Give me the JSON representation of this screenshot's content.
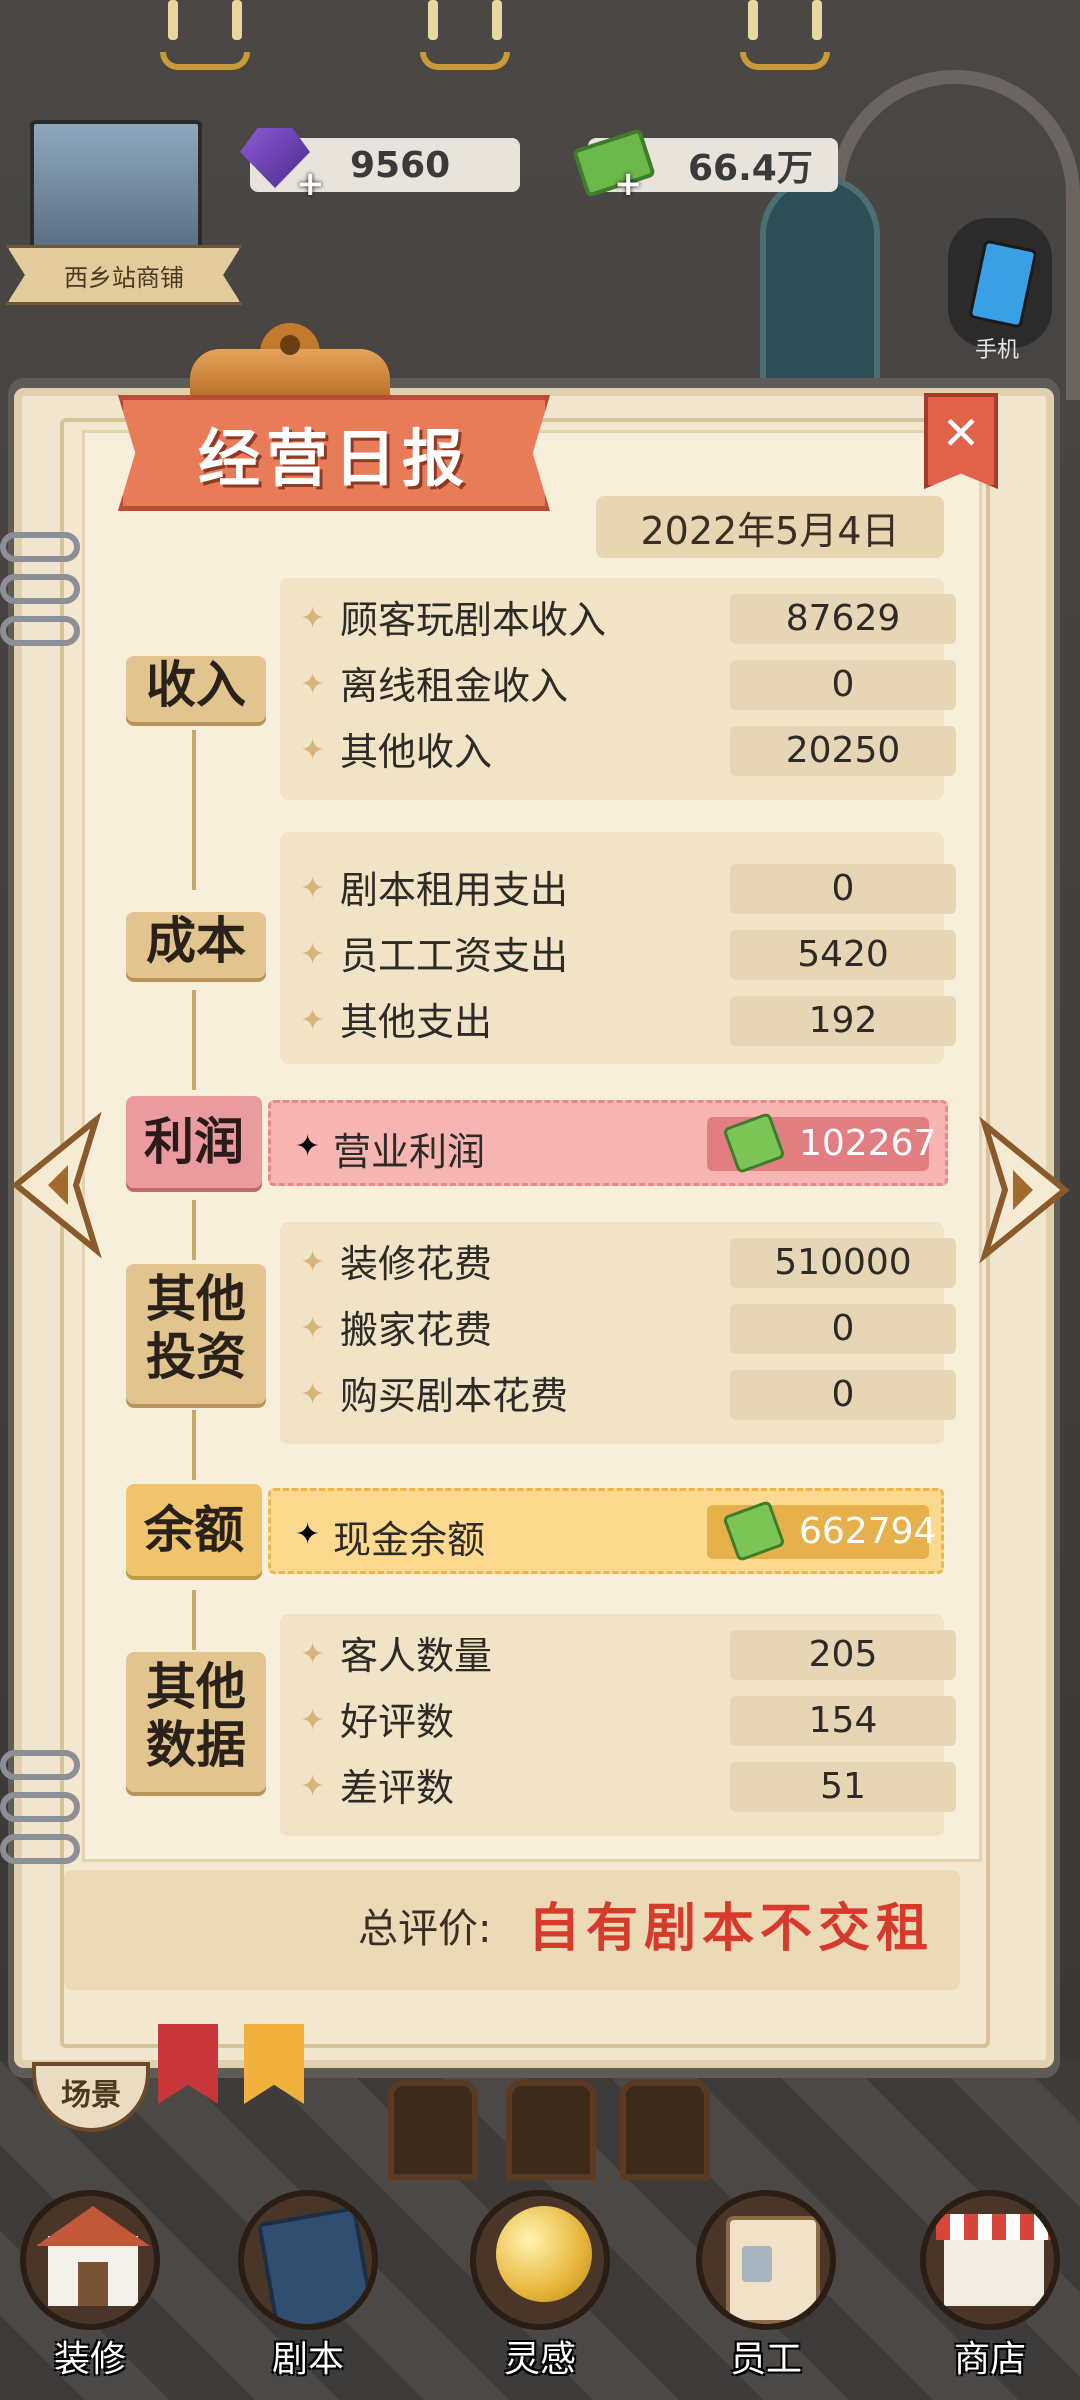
{
  "topbar": {
    "gems": "9560",
    "cash": "66.4万",
    "shop_name": "西乡站商铺",
    "phone_label": "手机"
  },
  "report": {
    "title": "经营日报",
    "close_symbol": "✕",
    "date": "2022年5月4日",
    "income": {
      "category": "收入",
      "rows": [
        {
          "label": "顾客玩剧本收入",
          "value": "87629"
        },
        {
          "label": "离线租金收入",
          "value": "0"
        },
        {
          "label": "其他收入",
          "value": "20250"
        }
      ]
    },
    "cost": {
      "category": "成本",
      "rows": [
        {
          "label": "剧本租用支出",
          "value": "0"
        },
        {
          "label": "员工工资支出",
          "value": "5420"
        },
        {
          "label": "其他支出",
          "value": "192"
        }
      ]
    },
    "profit": {
      "category": "利润",
      "label": "营业利润",
      "value": "102267"
    },
    "investment": {
      "category_line1": "其他",
      "category_line2": "投资",
      "rows": [
        {
          "label": "装修花费",
          "value": "510000"
        },
        {
          "label": "搬家花费",
          "value": "0"
        },
        {
          "label": "购买剧本花费",
          "value": "0"
        }
      ]
    },
    "balance": {
      "category": "余额",
      "label": "现金余额",
      "value": "662794"
    },
    "other_data": {
      "category_line1": "其他",
      "category_line2": "数据",
      "rows": [
        {
          "label": "客人数量",
          "value": "205"
        },
        {
          "label": "好评数",
          "value": "154"
        },
        {
          "label": "差评数",
          "value": "51"
        }
      ]
    },
    "summary_label": "总评价:",
    "summary_value": "自有剧本不交租",
    "star_glyph": "✦"
  },
  "scene_button": "场景",
  "nav": [
    {
      "label": "装修",
      "icon": "house-icon"
    },
    {
      "label": "剧本",
      "icon": "script-book-icon"
    },
    {
      "label": "灵感",
      "icon": "crystal-ball-icon"
    },
    {
      "label": "员工",
      "icon": "staff-badge-icon"
    },
    {
      "label": "商店",
      "icon": "shop-icon"
    }
  ],
  "colors": {
    "title_banner": "#e87b58",
    "profit_band": "#f6b4b2",
    "balance_band": "#fbd98f",
    "summary_text": "#d63a2c"
  }
}
